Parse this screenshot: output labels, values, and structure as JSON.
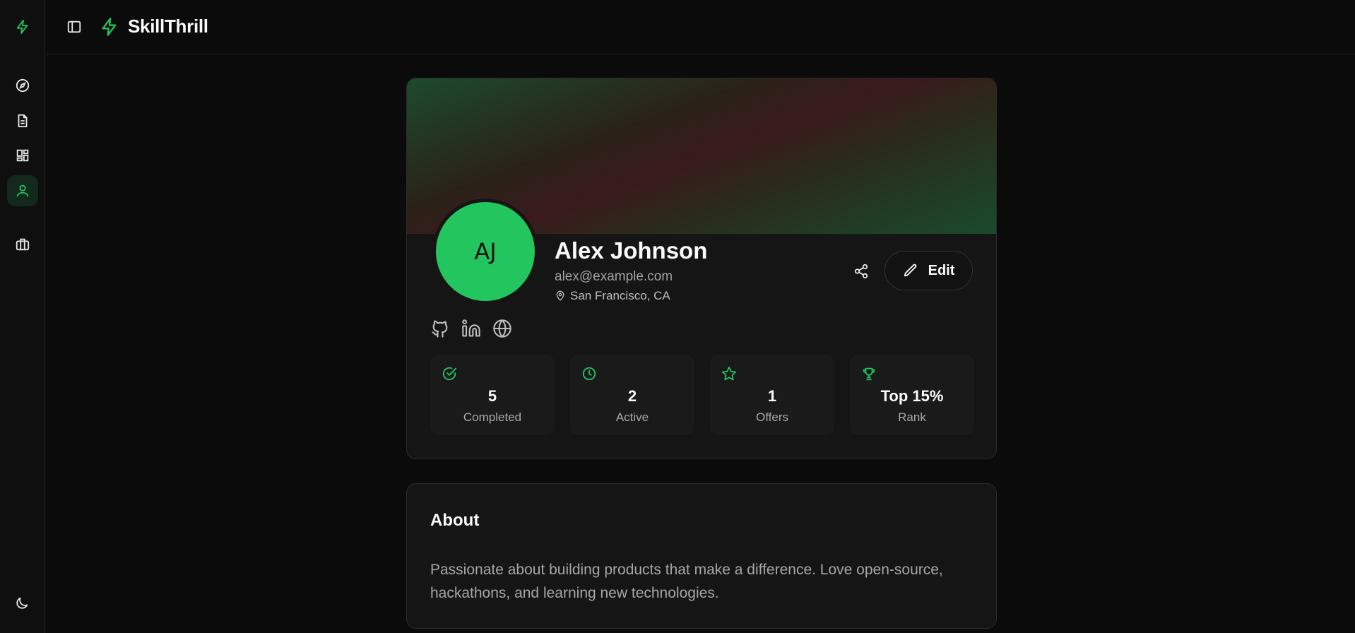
{
  "app": {
    "name": "SkillThrill"
  },
  "colors": {
    "accent": "#22c55e",
    "background": "#0b0b0b",
    "card": "#151515"
  },
  "sidebar": {
    "items": [
      {
        "icon": "compass-icon",
        "active": false
      },
      {
        "icon": "document-icon",
        "active": false
      },
      {
        "icon": "dashboard-icon",
        "active": false
      },
      {
        "icon": "user-icon",
        "active": true
      },
      {
        "icon": "briefcase-icon",
        "active": false
      }
    ],
    "theme_icon": "moon-icon"
  },
  "profile": {
    "initials": "AJ",
    "name": "Alex Johnson",
    "email": "alex@example.com",
    "location": "San Francisco, CA",
    "edit_label": "Edit",
    "socials": [
      "github-icon",
      "linkedin-icon",
      "globe-icon"
    ],
    "stats": [
      {
        "icon": "check-circle-icon",
        "value": "5",
        "label": "Completed"
      },
      {
        "icon": "clock-icon",
        "value": "2",
        "label": "Active"
      },
      {
        "icon": "star-icon",
        "value": "1",
        "label": "Offers"
      },
      {
        "icon": "trophy-icon",
        "value": "Top 15%",
        "label": "Rank"
      }
    ]
  },
  "about": {
    "title": "About",
    "text": "Passionate about building products that make a difference. Love open-source, hackathons, and learning new technologies."
  }
}
